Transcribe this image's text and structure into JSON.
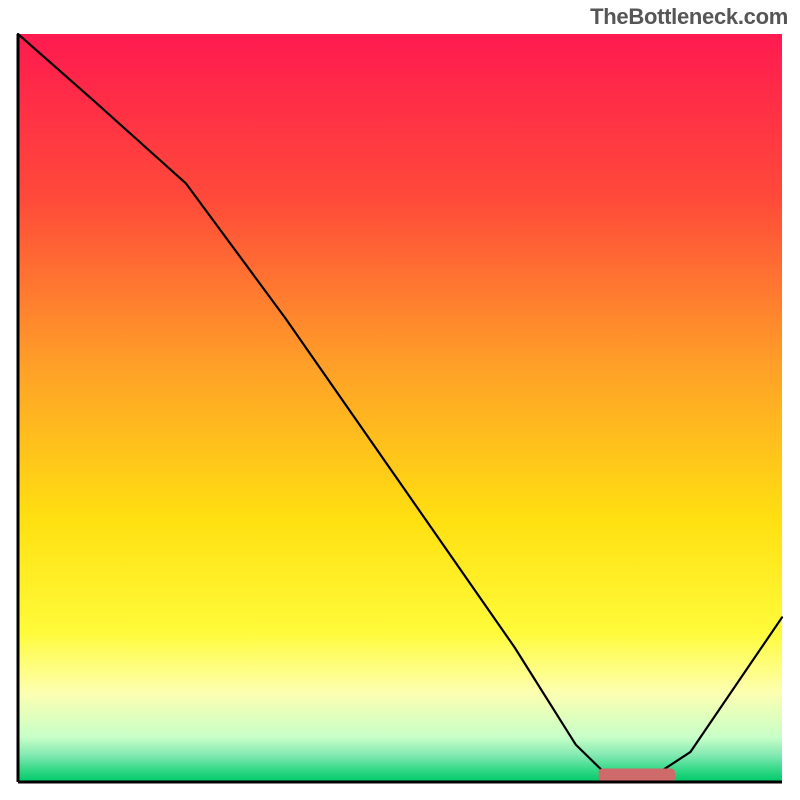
{
  "attribution": "TheBottleneck.com",
  "chart_data": {
    "type": "line",
    "title": "",
    "xlabel": "",
    "ylabel": "",
    "xlim": [
      0,
      100
    ],
    "ylim": [
      0,
      100
    ],
    "background": {
      "gradient_type": "vertical",
      "stops": [
        {
          "pos": 0.0,
          "color": "#ff1a4f"
        },
        {
          "pos": 0.22,
          "color": "#ff4a3a"
        },
        {
          "pos": 0.45,
          "color": "#ffa227"
        },
        {
          "pos": 0.65,
          "color": "#ffe011"
        },
        {
          "pos": 0.8,
          "color": "#fffb3a"
        },
        {
          "pos": 0.88,
          "color": "#fdffb0"
        },
        {
          "pos": 0.94,
          "color": "#c8ffc8"
        },
        {
          "pos": 0.965,
          "color": "#7fe8b0"
        },
        {
          "pos": 0.985,
          "color": "#2fd883"
        },
        {
          "pos": 1.0,
          "color": "#00c86a"
        }
      ]
    },
    "series": [
      {
        "name": "curve",
        "color": "#000000",
        "width": 2.2,
        "x": [
          0,
          10,
          22,
          35,
          50,
          65,
          73,
          78,
          82,
          88,
          100
        ],
        "y": [
          100,
          91,
          80,
          62,
          40,
          18,
          5,
          0,
          0,
          4,
          22
        ]
      }
    ],
    "marker": {
      "name": "highlight-bar",
      "color": "#cf6a6a",
      "x_start": 76,
      "x_end": 86,
      "y": 0,
      "height": 1.8
    },
    "axes": {
      "color": "#000000",
      "width": 3
    }
  }
}
